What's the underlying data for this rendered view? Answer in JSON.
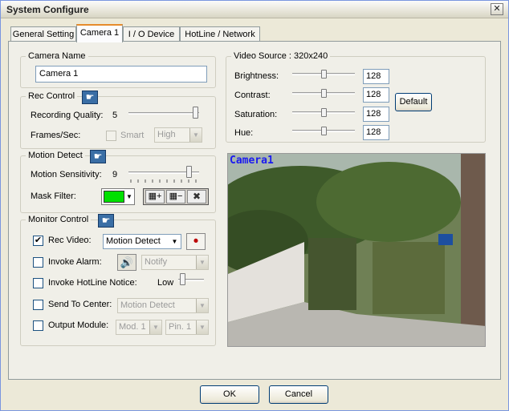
{
  "window": {
    "title": "System Configure",
    "close_glyph": "✕"
  },
  "tabs": [
    {
      "label": "General Setting",
      "active": false
    },
    {
      "label": "Camera 1",
      "active": true
    },
    {
      "label": "I / O Device",
      "active": false
    },
    {
      "label": "HotLine / Network",
      "active": false
    }
  ],
  "camera_name": {
    "legend": "Camera Name",
    "value": "Camera 1"
  },
  "rec_control": {
    "legend": "Rec Control",
    "quality_label": "Recording Quality:",
    "quality_value": "5",
    "quality_level": 1.0,
    "fps_label": "Frames/Sec:",
    "smart_label": "Smart",
    "fps_select": "High"
  },
  "motion_detect": {
    "legend": "Motion Detect",
    "sensitivity_label": "Motion Sensitivity:",
    "sensitivity_value": "9",
    "sensitivity_level": 0.9,
    "mask_label": "Mask Filter:",
    "mask_color": "#00e000"
  },
  "monitor_control": {
    "legend": "Monitor Control",
    "rec_video_label": "Rec Video:",
    "rec_video_checked": "✔",
    "rec_video_select": "Motion Detect",
    "invoke_alarm_label": "Invoke Alarm:",
    "alarm_select": "Notify",
    "hotline_label": "Invoke HotLine Notice:",
    "hotline_level_label": "Low",
    "send_center_label": "Send To Center:",
    "send_center_select": "Motion Detect",
    "output_module_label": "Output Module:",
    "module_select": "Mod. 1",
    "pin_select": "Pin. 1"
  },
  "video_source": {
    "legend": "Video Source : 320x240",
    "brightness_label": "Brightness:",
    "brightness_value": "128",
    "contrast_label": "Contrast:",
    "contrast_value": "128",
    "saturation_label": "Saturation:",
    "saturation_value": "128",
    "hue_label": "Hue:",
    "hue_value": "128",
    "default_button": "Default",
    "preview_overlay": "Camera1"
  },
  "footer": {
    "ok": "OK",
    "cancel": "Cancel"
  }
}
